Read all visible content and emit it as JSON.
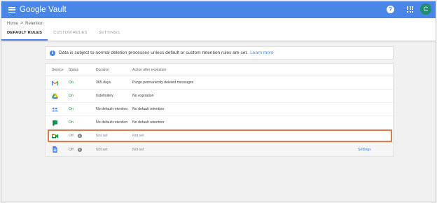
{
  "header": {
    "app_title": "Google Vault",
    "help_icon": "?",
    "avatar_letter": "C",
    "brand_color": "#4a86e8",
    "avatar_color": "#1e8e6e"
  },
  "breadcrumb": {
    "home": "Home",
    "separator": ">",
    "current": "Retention"
  },
  "tabs": [
    {
      "label": "DEFAULT RULES",
      "active": true
    },
    {
      "label": "CUSTOM RULES",
      "active": false
    },
    {
      "label": "SETTINGS",
      "active": false
    }
  ],
  "banner": {
    "icon": "i",
    "text": "Data is subject to normal deletion processes unless default or custom retention rules are set.",
    "link": "Learn more"
  },
  "table": {
    "columns": {
      "service": "Service",
      "status": "Status",
      "duration": "Duration",
      "action": "Action after expiration"
    },
    "rows": [
      {
        "service_icon": "gmail-icon",
        "status": "On",
        "duration": "365 days",
        "action": "Purge permanently deleted messages",
        "extra": ""
      },
      {
        "service_icon": "drive-icon",
        "status": "On",
        "duration": "Indefinitely",
        "action": "No expiration",
        "extra": ""
      },
      {
        "service_icon": "groups-icon",
        "status": "On",
        "duration": "No default retention",
        "action": "No default retention",
        "extra": ""
      },
      {
        "service_icon": "hangouts-chat-icon",
        "status": "On",
        "duration": "No default retention",
        "action": "No default retention",
        "extra": ""
      },
      {
        "service_icon": "meet-icon",
        "status": "Off",
        "duration": "Not set",
        "action": "Not set",
        "extra": ""
      },
      {
        "service_icon": "sites-icon",
        "status": "Off",
        "duration": "Not set",
        "action": "Not set",
        "extra": "Settings"
      }
    ],
    "info_glyph": "i"
  },
  "highlight_color": "#e07b47"
}
